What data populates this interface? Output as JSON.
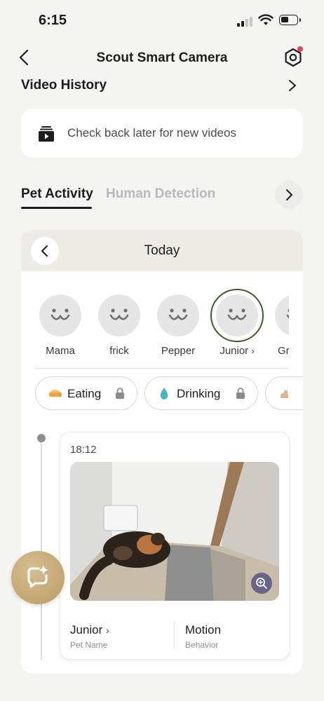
{
  "status": {
    "time": "6:15"
  },
  "header": {
    "title": "Scout Smart Camera",
    "settings_has_badge": true
  },
  "video_history": {
    "title": "Video History",
    "empty_message": "Check back later for new videos"
  },
  "tabs": [
    {
      "label": "Pet Activity",
      "active": true
    },
    {
      "label": "Human Detection",
      "active": false
    }
  ],
  "activity": {
    "date_label": "Today",
    "pets": [
      {
        "name": "Mama",
        "selected": false
      },
      {
        "name": "frick",
        "selected": false
      },
      {
        "name": "Pepper",
        "selected": false
      },
      {
        "name": "Junior",
        "chevron": "›",
        "selected": true
      },
      {
        "name": "Gr",
        "selected": false
      }
    ],
    "filters": [
      {
        "label": "Eating",
        "icon": "bowl-icon",
        "locked": true
      },
      {
        "label": "Drinking",
        "icon": "water-drop-icon",
        "locked": true
      },
      {
        "label": "",
        "icon": "cat-icon",
        "locked": false
      }
    ],
    "events": [
      {
        "time": "18:12",
        "pet_name": "Junior",
        "pet_name_chevron": "›",
        "pet_name_label": "Pet Name",
        "behavior": "Motion",
        "behavior_label": "Behavior"
      }
    ]
  },
  "colors": {
    "accent_gold": "#c2a46c",
    "selected_ring": "#3f5a2a",
    "notification": "#e5484d"
  }
}
